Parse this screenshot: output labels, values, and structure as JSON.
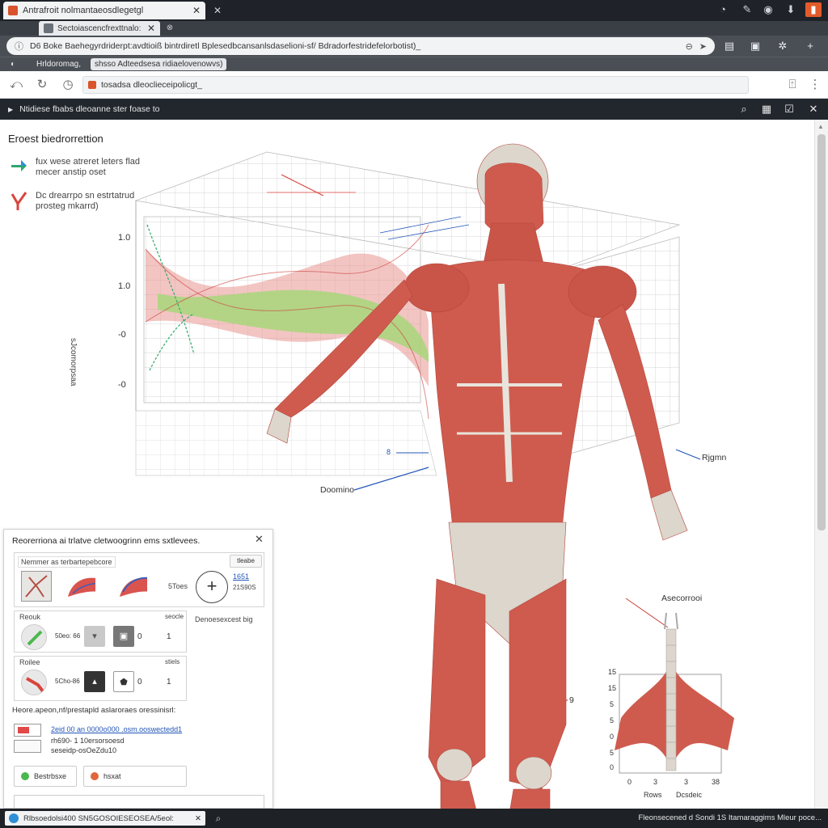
{
  "browser": {
    "tab_title": "Antrafroit nolmantaeosdlegetgl",
    "tab2_title": "Sectoiascencfrexttnalo:",
    "url": "D6 Boke Baehegyrdriderpt:avdtioiß bintrdiretl Bplesedbcansanlsdaselioni-sf/ Bdradorfestridefelorbotist)_",
    "bookmarks": [
      "Hrldoromag,",
      "shsso Adteedsesa ridiaelovenowvs)"
    ],
    "search_value": "tosadsa dleoclieceipolicgt_",
    "app_title": "Ntidiese fbabs dleoanne ster foase to"
  },
  "viewport": {
    "heading": "Eroest biedrorrettion",
    "legend": [
      {
        "icon": "green-arrow-icon",
        "text": "fux wese atreret leters flad mecer anstip oset"
      },
      {
        "icon": "red-check-icon",
        "text": "Dc drearrpo sn estrtatrud prosteg mkarrd)"
      }
    ],
    "y_axis_label": "sJcomorpsaa",
    "y_ticks": [
      "1.0",
      "1.0",
      "-0",
      "-0"
    ],
    "callouts": {
      "left_small": "8",
      "dooming": "Doomino",
      "right": "Rjgmn",
      "ascent": "Asecorrooi",
      "lower": "9"
    },
    "spine_ticks": [
      "15",
      "15",
      "5",
      "5",
      "0",
      "5",
      "0"
    ],
    "spine_x_ticks": [
      "0",
      "3",
      "3",
      "38"
    ],
    "spine_footer": [
      "Rows",
      "Dcsdeic"
    ]
  },
  "panel": {
    "title": "Reorerriona ai trlatve cletwoogrinn ems sxtlevees.",
    "group_label": "Nemmer as terbartepebcore",
    "group_button": "tleabe",
    "swatch_label": "5Toes",
    "swatch_value": "1651",
    "swatch_value_2": "21S90S",
    "side_note": "Denoesexcest big",
    "subgroups": [
      {
        "title": "Reouk",
        "right": "seocle",
        "val": "50eo: 66",
        "n1": "0",
        "n2": "1"
      },
      {
        "title": "Roilee",
        "right": "stiels",
        "val": "5Cho-86",
        "n1": "0",
        "n2": "1"
      }
    ],
    "desc": "Heore.apeon,nf/prestapld aslaroraes oressinisrl:",
    "layers": [
      "2eid 00 an 0000o000 .osm.ooswectedd1",
      "rh690- 1 10ersorsoesd",
      "seseidp-osOeZdu10"
    ],
    "buttons": [
      "Bestrbsxe",
      "hsxat"
    ]
  },
  "taskbar": {
    "field": "Rlbsoedolsi400 SN5GOSOIESEOSEA/5eol:",
    "status": "Fleonsecened d Sondi 1S Itamaraggims Mleur poce..."
  },
  "colors": {
    "muscle": "#cf5b4e",
    "bone": "#dedad3",
    "chart_red": "#d9534f",
    "chart_green": "#a8d67a",
    "accent_blue": "#2456b8"
  }
}
